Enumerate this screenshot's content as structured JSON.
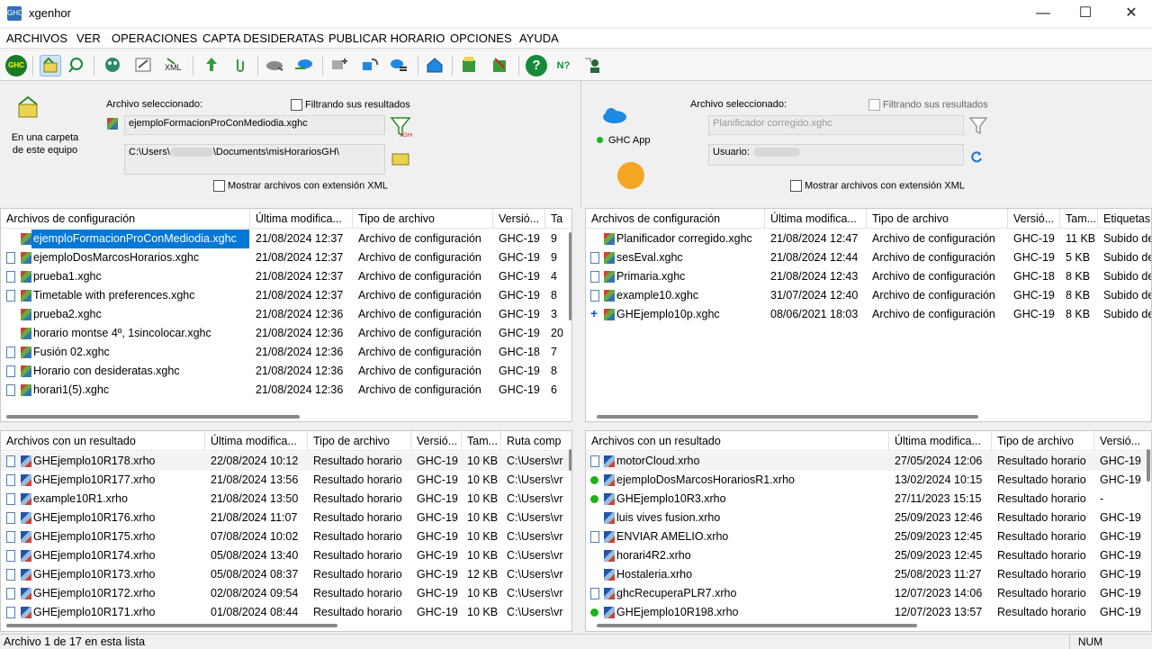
{
  "window": {
    "title": "xgenhor",
    "icon_label": "GHC",
    "minimize": "—",
    "maximize": "☐",
    "close": "✕"
  },
  "menu": [
    "ARCHIVOS",
    "VER",
    "OPERACIONES",
    "CAPTA DESIDERATAS",
    "PUBLICAR HORARIO",
    "OPCIONES",
    "AYUDA"
  ],
  "toolbar": {
    "icons": [
      "ghc-logo-icon",
      "folder-computer-icon",
      "search-icon",
      "globe-people-icon",
      "export-icon",
      "xml-icon",
      "upload-arrow-icon",
      "attachment-icon",
      "cloud-download-icon",
      "cloud-upload-icon",
      "network-add-icon",
      "network-sync-icon",
      "network-list-icon",
      "publish-home-icon",
      "server-sync-icon",
      "server-tools-icon",
      "help-icon",
      "whats-this-icon",
      "user-network-icon"
    ],
    "ghc_label": "GHC",
    "help_glyph": "?",
    "whatsthis_glyph": "N?"
  },
  "colors": {
    "selected": "#0078d7",
    "green": "#1bb31b",
    "blue_plus": "#0b4fd6"
  },
  "left_panel": {
    "location_label": "En una carpeta de este equipo",
    "file_caption": "Archivo seleccionado:",
    "filter_label": "Filtrando sus resultados",
    "selected_file": "ejemploFormacionProConMediodia.xghc",
    "path_prefix": "C:\\Users\\",
    "path_suffix": "\\Documents\\misHorariosGH\\",
    "xml_toggle": "Mostrar archivos con extensión XML",
    "config_headers": [
      "Archivos de configuración",
      "Última modifica...",
      "Tipo de archivo",
      "Versió...",
      "Ta"
    ],
    "config_rows": [
      {
        "name": "ejemploFormacionProConMediodia.xghc",
        "date": "21/08/2024",
        "time": "12:37",
        "type": "Archivo de configuración",
        "ver": "GHC-19",
        "size": "9",
        "mini": false,
        "selected": true
      },
      {
        "name": "ejemploDosMarcosHorarios.xghc",
        "date": "21/08/2024",
        "time": "12:37",
        "type": "Archivo de configuración",
        "ver": "GHC-19",
        "size": "9",
        "mini": true,
        "selected": false
      },
      {
        "name": "prueba1.xghc",
        "date": "21/08/2024",
        "time": "12:37",
        "type": "Archivo de configuración",
        "ver": "GHC-19",
        "size": "4",
        "mini": true,
        "selected": false
      },
      {
        "name": "Timetable with preferences.xghc",
        "date": "21/08/2024",
        "time": "12:37",
        "type": "Archivo de configuración",
        "ver": "GHC-19",
        "size": "8",
        "mini": true,
        "selected": false
      },
      {
        "name": "prueba2.xghc",
        "date": "21/08/2024",
        "time": "12:36",
        "type": "Archivo de configuración",
        "ver": "GHC-19",
        "size": "3",
        "mini": false,
        "selected": false
      },
      {
        "name": "horario montse 4º, 1sincolocar.xghc",
        "date": "21/08/2024",
        "time": "12:36",
        "type": "Archivo de configuración",
        "ver": "GHC-19",
        "size": "20",
        "mini": false,
        "selected": false
      },
      {
        "name": "Fusión 02.xghc",
        "date": "21/08/2024",
        "time": "12:36",
        "type": "Archivo de configuración",
        "ver": "GHC-18",
        "size": "7",
        "mini": true,
        "selected": false
      },
      {
        "name": "Horario con desideratas.xghc",
        "date": "21/08/2024",
        "time": "12:36",
        "type": "Archivo de configuración",
        "ver": "GHC-19",
        "size": "8",
        "mini": true,
        "selected": false
      },
      {
        "name": "horari1(5).xghc",
        "date": "21/08/2024",
        "time": "12:36",
        "type": "Archivo de configuración",
        "ver": "GHC-19",
        "size": "6",
        "mini": true,
        "selected": false
      }
    ],
    "result_headers": [
      "Archivos con un resultado",
      "Última modifica...",
      "Tipo de archivo",
      "Versió...",
      "Tam...",
      "Ruta comp"
    ],
    "result_rows": [
      {
        "name": "GHEjemplo10R178.xrho",
        "date": "22/08/2024",
        "time": "10:12",
        "type": "Resultado horario",
        "ver": "GHC-19",
        "size": "10 KB",
        "path": "C:\\Users\\vr",
        "mini": true,
        "selected": false
      },
      {
        "name": "GHEjemplo10R177.xrho",
        "date": "21/08/2024",
        "time": "13:56",
        "type": "Resultado horario",
        "ver": "GHC-19",
        "size": "10 KB",
        "path": "C:\\Users\\vr",
        "mini": true,
        "selected": false
      },
      {
        "name": "example10R1.xrho",
        "date": "21/08/2024",
        "time": "13:50",
        "type": "Resultado horario",
        "ver": "GHC-19",
        "size": "10 KB",
        "path": "C:\\Users\\vr",
        "mini": true,
        "selected": false
      },
      {
        "name": "GHEjemplo10R176.xrho",
        "date": "21/08/2024",
        "time": "11:07",
        "type": "Resultado horario",
        "ver": "GHC-19",
        "size": "10 KB",
        "path": "C:\\Users\\vr",
        "mini": true,
        "selected": false
      },
      {
        "name": "GHEjemplo10R175.xrho",
        "date": "07/08/2024",
        "time": "10:02",
        "type": "Resultado horario",
        "ver": "GHC-19",
        "size": "10 KB",
        "path": "C:\\Users\\vr",
        "mini": true,
        "selected": false
      },
      {
        "name": "GHEjemplo10R174.xrho",
        "date": "05/08/2024",
        "time": "13:40",
        "type": "Resultado horario",
        "ver": "GHC-19",
        "size": "10 KB",
        "path": "C:\\Users\\vr",
        "mini": true,
        "selected": false
      },
      {
        "name": "GHEjemplo10R173.xrho",
        "date": "05/08/2024",
        "time": "08:37",
        "type": "Resultado horario",
        "ver": "GHC-19",
        "size": "12 KB",
        "path": "C:\\Users\\vr",
        "mini": true,
        "selected": false
      },
      {
        "name": "GHEjemplo10R172.xrho",
        "date": "02/08/2024",
        "time": "09:54",
        "type": "Resultado horario",
        "ver": "GHC-19",
        "size": "10 KB",
        "path": "C:\\Users\\vr",
        "mini": true,
        "selected": false
      },
      {
        "name": "GHEjemplo10R171.xrho",
        "date": "01/08/2024",
        "time": "08:44",
        "type": "Resultado horario",
        "ver": "GHC-19",
        "size": "10 KB",
        "path": "C:\\Users\\vr",
        "mini": true,
        "selected": false
      }
    ]
  },
  "right_panel": {
    "location_label": "GHC App",
    "file_caption": "Archivo seleccionado:",
    "filter_label": "Filtrando sus resultados",
    "selected_file_placeholder": "Planificador corregido.xghc",
    "user_label": "Usuario:",
    "xml_toggle": "Mostrar archivos con extensión XML",
    "config_headers": [
      "Archivos de configuración",
      "Última modifica...",
      "Tipo de archivo",
      "Versió...",
      "Tam...",
      "Etiquetas"
    ],
    "config_rows": [
      {
        "name": "Planificador corregido.xghc",
        "date": "21/08/2024",
        "time": "12:47",
        "type": "Archivo de configuración",
        "ver": "GHC-19",
        "size": "11 KB",
        "tag": "Subido de",
        "marker": "none"
      },
      {
        "name": "sesEval.xghc",
        "date": "21/08/2024",
        "time": "12:44",
        "type": "Archivo de configuración",
        "ver": "GHC-19",
        "size": "5 KB",
        "tag": "Subido de",
        "marker": "mini"
      },
      {
        "name": "Primaria.xghc",
        "date": "21/08/2024",
        "time": "12:43",
        "type": "Archivo de configuración",
        "ver": "GHC-18",
        "size": "8 KB",
        "tag": "Subido de",
        "marker": "mini"
      },
      {
        "name": "example10.xghc",
        "date": "31/07/2024",
        "time": "12:40",
        "type": "Archivo de configuración",
        "ver": "GHC-19",
        "size": "8 KB",
        "tag": "Subido de",
        "marker": "mini"
      },
      {
        "name": "GHEjemplo10p.xghc",
        "date": "08/06/2021",
        "time": "18:03",
        "type": "Archivo de configuración",
        "ver": "GHC-19",
        "size": "8 KB",
        "tag": "Subido de",
        "marker": "plus"
      }
    ],
    "result_headers": [
      "Archivos con un resultado",
      "Última modifica...",
      "Tipo de archivo",
      "Versió..."
    ],
    "result_rows": [
      {
        "name": "motorCloud.xrho",
        "date": "27/05/2024",
        "time": "12:06",
        "type": "Resultado horario",
        "ver": "GHC-19",
        "marker": "mini",
        "selected": true
      },
      {
        "name": "ejemploDosMarcosHorariosR1.xrho",
        "date": "13/02/2024",
        "time": "10:15",
        "type": "Resultado horario",
        "ver": "GHC-19",
        "marker": "green",
        "selected": false
      },
      {
        "name": "GHEjemplo10R3.xrho",
        "date": "27/11/2023",
        "time": "15:15",
        "type": "Resultado horario",
        "ver": "-",
        "marker": "green",
        "selected": false
      },
      {
        "name": "luis vives fusion.xrho",
        "date": "25/09/2023",
        "time": "12:46",
        "type": "Resultado horario",
        "ver": "GHC-19",
        "marker": "none",
        "selected": false
      },
      {
        "name": "ENVIAR AMELIO.xrho",
        "date": "25/09/2023",
        "time": "12:45",
        "type": "Resultado horario",
        "ver": "GHC-19",
        "marker": "mini",
        "selected": false
      },
      {
        "name": "horari4R2.xrho",
        "date": "25/09/2023",
        "time": "12:45",
        "type": "Resultado horario",
        "ver": "GHC-19",
        "marker": "none",
        "selected": false
      },
      {
        "name": "Hostaleria.xrho",
        "date": "25/08/2023",
        "time": "11:27",
        "type": "Resultado horario",
        "ver": "GHC-19",
        "marker": "none",
        "selected": false
      },
      {
        "name": "ghcRecuperaPLR7.xrho",
        "date": "12/07/2023",
        "time": "14:06",
        "type": "Resultado horario",
        "ver": "GHC-19",
        "marker": "mini",
        "selected": false
      },
      {
        "name": "GHEjemplo10R198.xrho",
        "date": "12/07/2023",
        "time": "13:57",
        "type": "Resultado horario",
        "ver": "GHC-19",
        "marker": "green",
        "selected": false
      }
    ]
  },
  "status": {
    "text": "Archivo 1 de 17 en esta lista",
    "num": "NUM"
  }
}
